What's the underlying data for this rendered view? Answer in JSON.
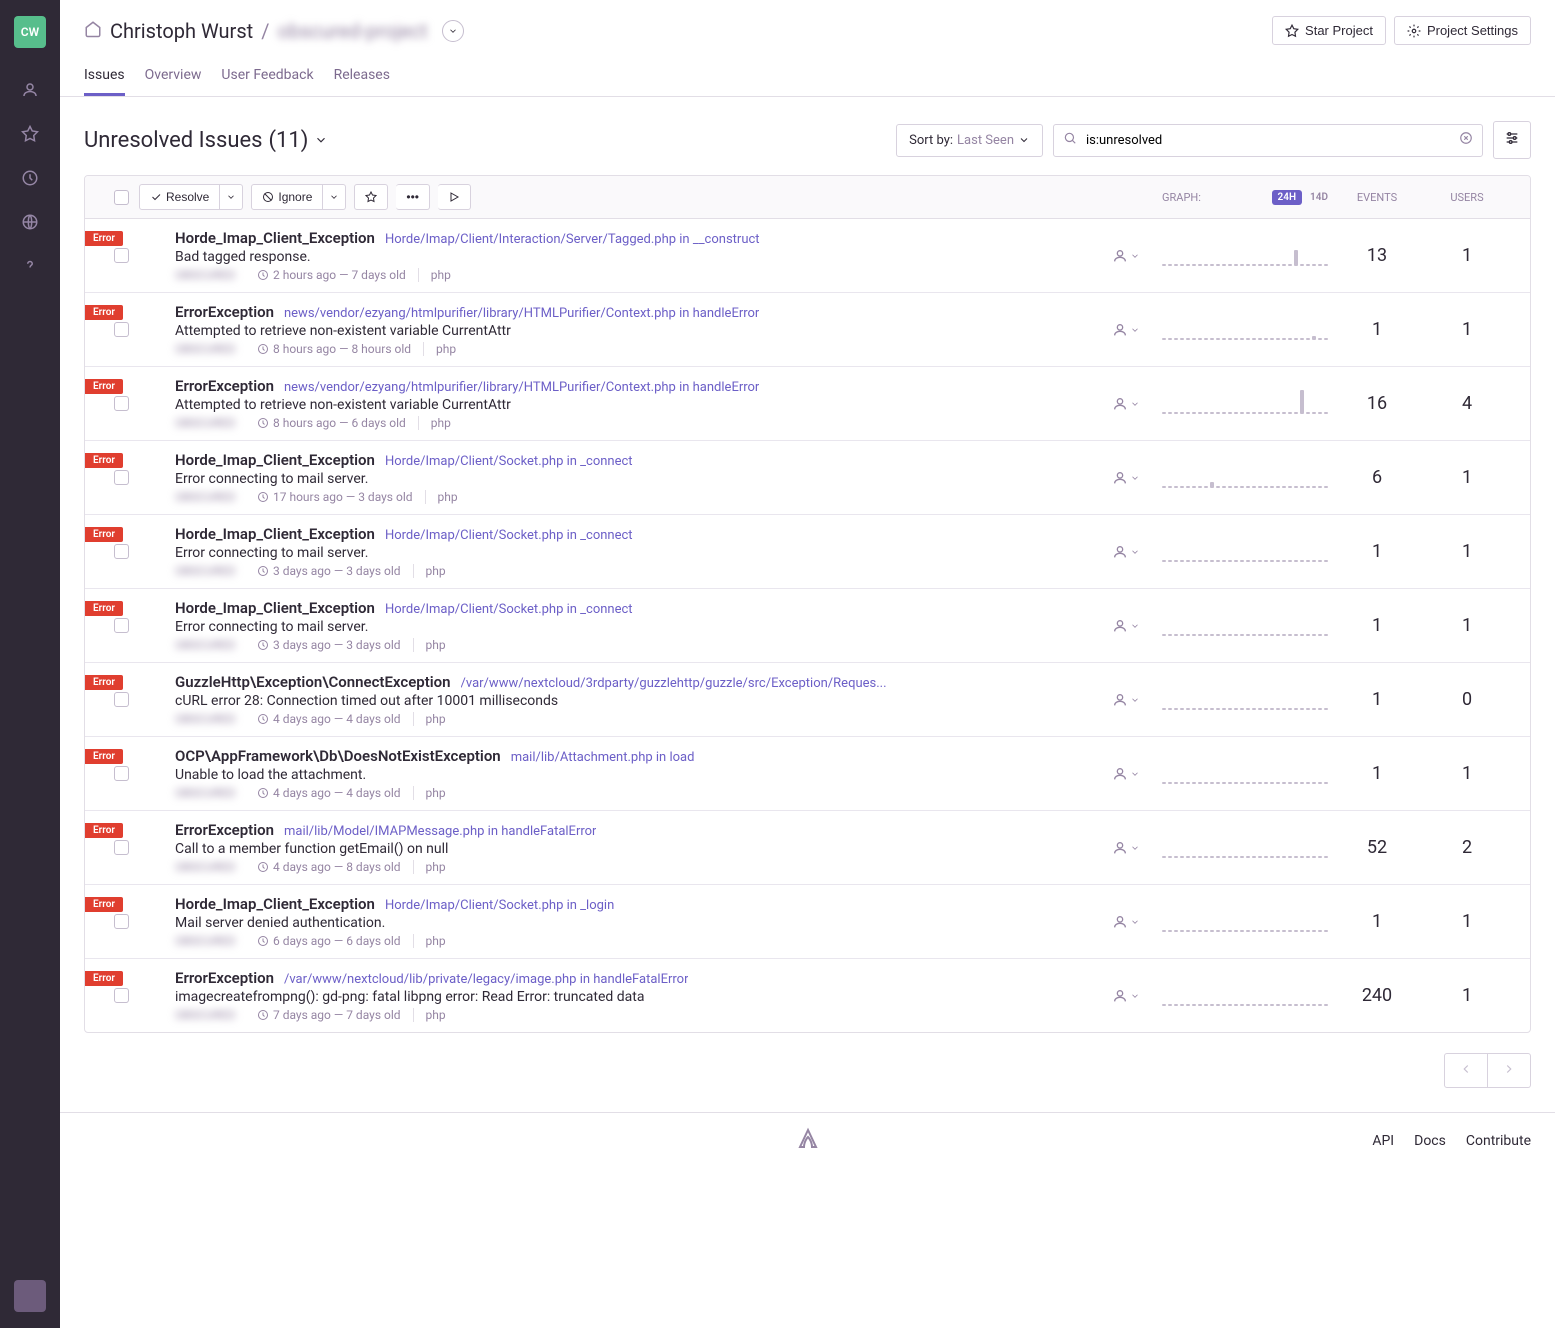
{
  "sidebar": {
    "logo": "CW"
  },
  "breadcrumb": {
    "owner": "Christoph Wurst",
    "project": "obscured-project"
  },
  "header_buttons": {
    "star": "Star Project",
    "settings": "Project Settings"
  },
  "nav_tabs": [
    "Issues",
    "Overview",
    "User Feedback",
    "Releases"
  ],
  "page_title": "Unresolved Issues",
  "issue_count": "(11)",
  "sort": {
    "label": "Sort by:",
    "value": "Last Seen"
  },
  "search": {
    "placeholder": "is:unresolved",
    "value": "is:unresolved"
  },
  "actions": {
    "resolve": "Resolve",
    "ignore": "Ignore"
  },
  "cols": {
    "graph": "GRAPH:",
    "badge24": "24H",
    "badge14": "14D",
    "events": "EVENTS",
    "users": "USERS"
  },
  "level": "Error",
  "issues": [
    {
      "title": "Horde_Imap_Client_Exception",
      "location": "Horde/Imap/Client/Interaction/Server/Tagged.php in __construct",
      "message": "Bad tagged response.",
      "time": "2 hours ago — 7 days old",
      "tag": "php",
      "events": "13",
      "users": "1",
      "spark": [
        1,
        1,
        1,
        1,
        1,
        1,
        1,
        1,
        1,
        1,
        1,
        1,
        1,
        1,
        1,
        1,
        1,
        1,
        1,
        1,
        1,
        1,
        8,
        1,
        1,
        1,
        1,
        1
      ]
    },
    {
      "title": "ErrorException",
      "location": "news/vendor/ezyang/htmlpurifier/library/HTMLPurifier/Context.php in handleError",
      "message": "Attempted to retrieve non-existent variable CurrentAttr",
      "time": "8 hours ago — 8 hours old",
      "tag": "php",
      "events": "1",
      "users": "1",
      "spark": [
        1,
        1,
        1,
        1,
        1,
        1,
        1,
        1,
        1,
        1,
        1,
        1,
        1,
        1,
        1,
        1,
        1,
        1,
        1,
        1,
        1,
        1,
        1,
        1,
        1,
        2,
        1,
        1
      ]
    },
    {
      "title": "ErrorException",
      "location": "news/vendor/ezyang/htmlpurifier/library/HTMLPurifier/Context.php in handleError",
      "message": "Attempted to retrieve non-existent variable CurrentAttr",
      "time": "8 hours ago — 6 days old",
      "tag": "php",
      "events": "16",
      "users": "4",
      "spark": [
        1,
        1,
        1,
        1,
        1,
        1,
        1,
        1,
        1,
        1,
        1,
        1,
        1,
        1,
        1,
        1,
        1,
        1,
        1,
        1,
        1,
        1,
        1,
        12,
        1,
        1,
        1,
        1
      ]
    },
    {
      "title": "Horde_Imap_Client_Exception",
      "location": "Horde/Imap/Client/Socket.php in _connect",
      "message": "Error connecting to mail server.",
      "time": "17 hours ago — 3 days old",
      "tag": "php",
      "events": "6",
      "users": "1",
      "spark": [
        1,
        1,
        1,
        1,
        1,
        1,
        1,
        1,
        3,
        1,
        1,
        1,
        1,
        1,
        1,
        1,
        1,
        1,
        1,
        1,
        1,
        1,
        1,
        1,
        1,
        1,
        1,
        1
      ]
    },
    {
      "title": "Horde_Imap_Client_Exception",
      "location": "Horde/Imap/Client/Socket.php in _connect",
      "message": "Error connecting to mail server.",
      "time": "3 days ago — 3 days old",
      "tag": "php",
      "events": "1",
      "users": "1",
      "spark": [
        1,
        1,
        1,
        1,
        1,
        1,
        1,
        1,
        1,
        1,
        1,
        1,
        1,
        1,
        1,
        1,
        1,
        1,
        1,
        1,
        1,
        1,
        1,
        1,
        1,
        1,
        1,
        1
      ]
    },
    {
      "title": "Horde_Imap_Client_Exception",
      "location": "Horde/Imap/Client/Socket.php in _connect",
      "message": "Error connecting to mail server.",
      "time": "3 days ago — 3 days old",
      "tag": "php",
      "events": "1",
      "users": "1",
      "spark": [
        1,
        1,
        1,
        1,
        1,
        1,
        1,
        1,
        1,
        1,
        1,
        1,
        1,
        1,
        1,
        1,
        1,
        1,
        1,
        1,
        1,
        1,
        1,
        1,
        1,
        1,
        1,
        1
      ]
    },
    {
      "title": "GuzzleHttp\\Exception\\ConnectException",
      "location": "/var/www/nextcloud/3rdparty/guzzlehttp/guzzle/src/Exception/Reques...",
      "message": "cURL error 28: Connection timed out after 10001 milliseconds",
      "time": "4 days ago — 4 days old",
      "tag": "php",
      "events": "1",
      "users": "0",
      "spark": [
        1,
        1,
        1,
        1,
        1,
        1,
        1,
        1,
        1,
        1,
        1,
        1,
        1,
        1,
        1,
        1,
        1,
        1,
        1,
        1,
        1,
        1,
        1,
        1,
        1,
        1,
        1,
        1
      ]
    },
    {
      "title": "OCP\\AppFramework\\Db\\DoesNotExistException",
      "location": "mail/lib/Attachment.php in load",
      "message": "Unable to load the attachment.",
      "time": "4 days ago — 4 days old",
      "tag": "php",
      "events": "1",
      "users": "1",
      "spark": [
        1,
        1,
        1,
        1,
        1,
        1,
        1,
        1,
        1,
        1,
        1,
        1,
        1,
        1,
        1,
        1,
        1,
        1,
        1,
        1,
        1,
        1,
        1,
        1,
        1,
        1,
        1,
        1
      ]
    },
    {
      "title": "ErrorException",
      "location": "mail/lib/Model/IMAPMessage.php in handleFatalError",
      "message": "Call to a member function getEmail() on null",
      "time": "4 days ago — 8 days old",
      "tag": "php",
      "events": "52",
      "users": "2",
      "spark": [
        1,
        1,
        1,
        1,
        1,
        1,
        1,
        1,
        1,
        1,
        1,
        1,
        1,
        1,
        1,
        1,
        1,
        1,
        1,
        1,
        1,
        1,
        1,
        1,
        1,
        1,
        1,
        1
      ]
    },
    {
      "title": "Horde_Imap_Client_Exception",
      "location": "Horde/Imap/Client/Socket.php in _login",
      "message": "Mail server denied authentication.",
      "time": "6 days ago — 6 days old",
      "tag": "php",
      "events": "1",
      "users": "1",
      "spark": [
        1,
        1,
        1,
        1,
        1,
        1,
        1,
        1,
        1,
        1,
        1,
        1,
        1,
        1,
        1,
        1,
        1,
        1,
        1,
        1,
        1,
        1,
        1,
        1,
        1,
        1,
        1,
        1
      ]
    },
    {
      "title": "ErrorException",
      "location": "/var/www/nextcloud/lib/private/legacy/image.php in handleFatalError",
      "message": "imagecreatefrompng(): gd-png: fatal libpng error: Read Error: truncated data",
      "time": "7 days ago — 7 days old",
      "tag": "php",
      "events": "240",
      "users": "1",
      "spark": [
        1,
        1,
        1,
        1,
        1,
        1,
        1,
        1,
        1,
        1,
        1,
        1,
        1,
        1,
        1,
        1,
        1,
        1,
        1,
        1,
        1,
        1,
        1,
        1,
        1,
        1,
        1,
        1
      ]
    }
  ],
  "footer": {
    "links": [
      "API",
      "Docs",
      "Contribute"
    ]
  }
}
